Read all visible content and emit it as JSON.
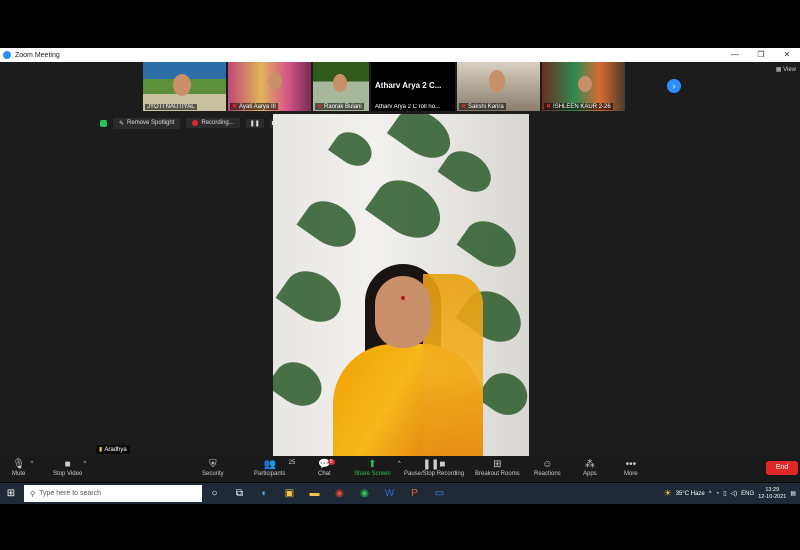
{
  "window": {
    "title": "Zoom Meeting",
    "controls": [
      "—",
      "❐",
      "✕"
    ]
  },
  "view_label": "View",
  "thumbnails": [
    {
      "name": "JYOTI NAUTIYAL",
      "muted": false
    },
    {
      "name": "Ayati Aarya III",
      "muted": true
    },
    {
      "name": "Raorak Bulani",
      "muted": true
    },
    {
      "name": "Atharv Arya 2 C roll no...",
      "muted": false,
      "big_text": "Atharv Arya 2 C..."
    },
    {
      "name": "Sakshi Karira",
      "muted": true
    },
    {
      "name": "ISHLEEN KAUR 2-26",
      "muted": true
    }
  ],
  "spotlight": {
    "remove_label": "Remove Spotlight",
    "recording_label": "Recording..."
  },
  "speaker_name": "Aradhya",
  "controls": {
    "mute": "Mute",
    "stop_video": "Stop Video",
    "security": "Security",
    "participants": "Participants",
    "participants_count": "25",
    "chat": "Chat",
    "chat_badge": "5",
    "share_screen": "Share Screen",
    "pause_stop_recording": "Pause/Stop Recording",
    "breakout_rooms": "Breakout Rooms",
    "reactions": "Reactions",
    "apps": "Apps",
    "more": "More",
    "end": "End"
  },
  "taskbar": {
    "search_placeholder": "Type here to search",
    "weather": "35°C Haze",
    "language": "ENG",
    "time": "13:29",
    "date": "12-10-2021"
  },
  "colors": {
    "zoom_blue": "#2d8cff",
    "share_green": "#23c552",
    "end_red": "#e02828"
  }
}
